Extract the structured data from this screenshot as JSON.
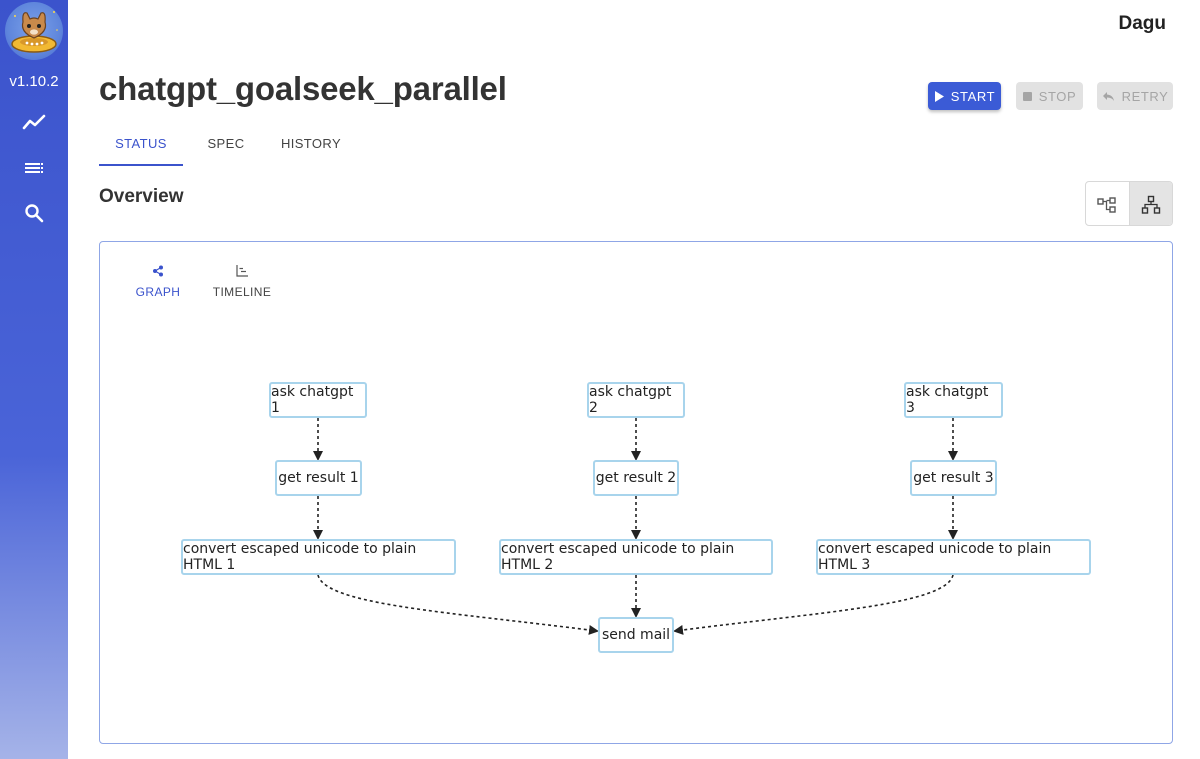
{
  "sidebar": {
    "version": "v1.10.2",
    "nav": [
      {
        "icon": "chart-line-icon"
      },
      {
        "icon": "list-icon"
      },
      {
        "icon": "search-icon"
      }
    ]
  },
  "header": {
    "brand": "Dagu",
    "title": "chatgpt_goalseek_parallel",
    "buttons": {
      "start": "START",
      "stop": "STOP",
      "retry": "RETRY"
    }
  },
  "tabs": [
    "STATUS",
    "SPEC",
    "HISTORY"
  ],
  "overview": {
    "title": "Overview",
    "subtabs": [
      "GRAPH",
      "TIMELINE"
    ]
  },
  "graph": {
    "nodes": {
      "ask1": "ask chatgpt 1",
      "ask2": "ask chatgpt 2",
      "ask3": "ask chatgpt 3",
      "get1": "get result 1",
      "get2": "get result 2",
      "get3": "get result 3",
      "conv1": "convert escaped unicode to plain HTML 1",
      "conv2": "convert escaped unicode to plain HTML 2",
      "conv3": "convert escaped unicode to plain HTML 3",
      "mail": "send mail"
    }
  },
  "colors": {
    "accent": "#3b53cc",
    "node_border": "#a8d4ec",
    "panel_border": "#8fa6e6"
  }
}
